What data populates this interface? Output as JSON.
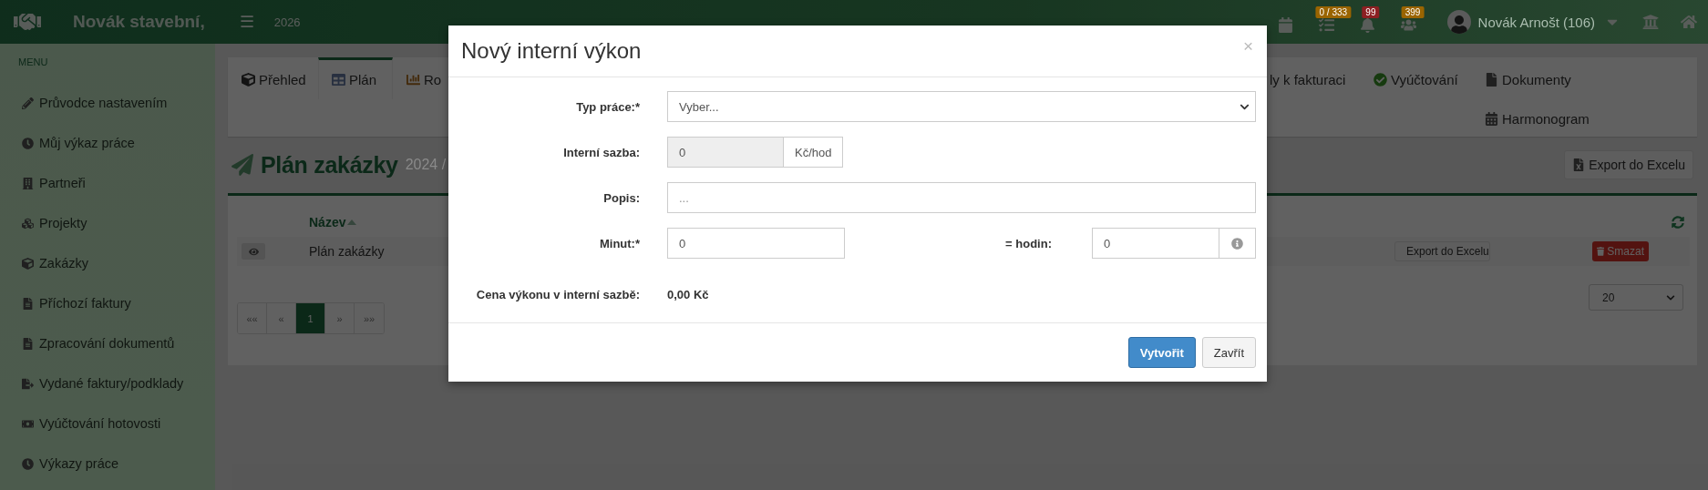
{
  "topbar": {
    "company": "Novák stavební,",
    "menu_toggle": "☰",
    "year": "2026",
    "notifications": [
      {
        "count": "0 / 333",
        "color": "#9a6400"
      },
      {
        "count": "99",
        "color": "#8c1f22"
      },
      {
        "count": "399",
        "color": "#9a6400"
      }
    ],
    "user": "Novák Arnošt (106)"
  },
  "sidebar": {
    "heading": "MENU",
    "items": [
      "Průvodce nastavením",
      "Můj výkaz práce",
      "Partneři",
      "Projekty",
      "Zakázky",
      "Příchozí faktury",
      "Zpracování dokumentů",
      "Vydané faktury/podklady",
      "Vyúčtování hotovosti",
      "Výkazy práce"
    ]
  },
  "tabs": [
    {
      "label": "Přehled",
      "selected": false
    },
    {
      "label": "Plán",
      "selected": true
    },
    {
      "label": "Ro",
      "selected": false
    },
    {
      "label": "ly k fakturaci",
      "selected": false
    },
    {
      "label": "Vyúčtování",
      "selected": false
    },
    {
      "label": "Dokumenty",
      "selected": false
    },
    {
      "label": "Harmonogram",
      "selected": false
    }
  ],
  "page": {
    "title": "Plán zakázky",
    "subtitle": "2024 /",
    "export_button": "Export do Excelu"
  },
  "table": {
    "columns": [
      {
        "label": "Název",
        "sort_ascending": true
      }
    ],
    "rows": [
      {
        "name": "Plán zakázky",
        "export_button": "Export do Excelu",
        "delete_button": "Smazat"
      }
    ]
  },
  "pagination": [
    {
      "label": "««",
      "selected": false
    },
    {
      "label": "«",
      "selected": false
    },
    {
      "label": "1",
      "selected": true
    },
    {
      "label": "»",
      "selected": false
    },
    {
      "label": "»»",
      "selected": false
    }
  ],
  "page_size": "20",
  "modal": {
    "title": "Nový interní výkon",
    "close": "×",
    "fields": [
      {
        "kind": "select",
        "label": "Typ práce:*",
        "value": "Vyber..."
      },
      {
        "kind": "unit",
        "label": "Interní sazba:",
        "value": "0",
        "unit": "Kč/hod",
        "disabled": true
      },
      {
        "kind": "text",
        "label": "Popis:",
        "placeholder": "..."
      },
      {
        "kind": "pair",
        "label": "Minut:*",
        "value": "0",
        "label2": "= hodin:",
        "value2": "0"
      },
      {
        "kind": "static",
        "label": "Cena výkonu v interní sazbě:",
        "value": "0,00 Kč"
      }
    ],
    "buttons": [
      {
        "label": "Vytvořit",
        "kind": "primary"
      },
      {
        "label": "Zavřít",
        "kind": "default"
      }
    ]
  }
}
